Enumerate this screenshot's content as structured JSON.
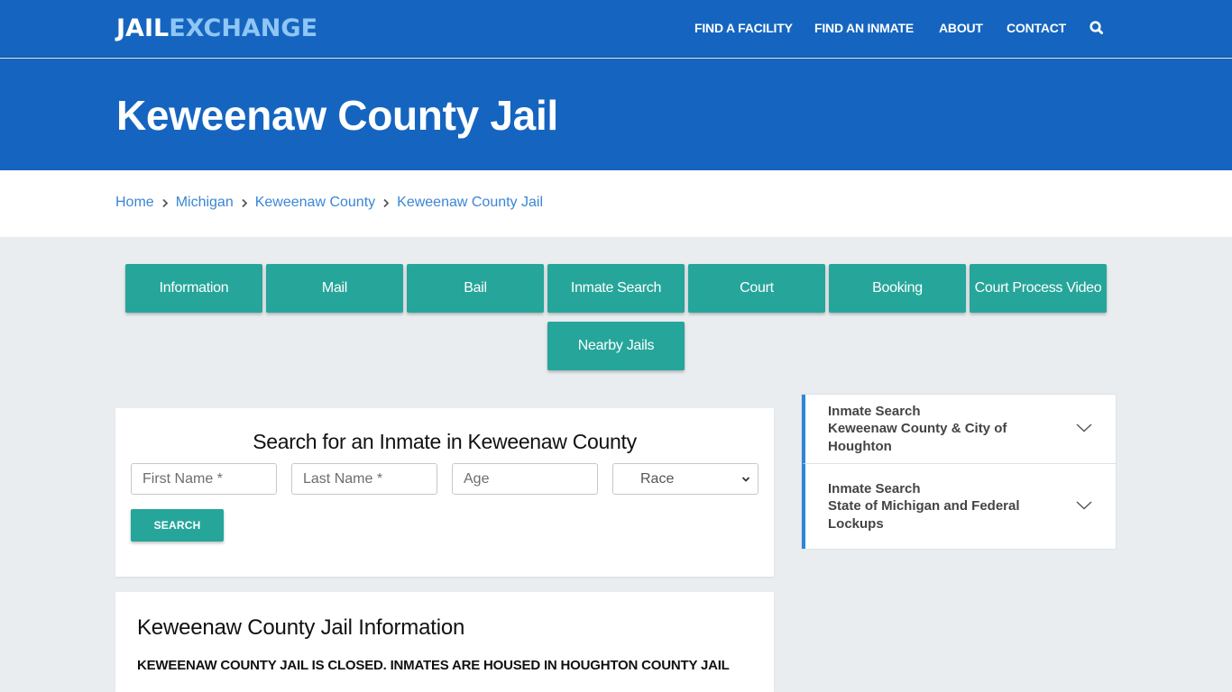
{
  "header": {
    "logo_part1": "JAIL",
    "logo_part2": "EXCHANGE",
    "nav": [
      "FIND A FACILITY",
      "FIND AN INMATE",
      "ABOUT",
      "CONTACT"
    ],
    "search_icon": "search-icon"
  },
  "hero": {
    "title": "Keweenaw County Jail"
  },
  "breadcrumb": [
    "Home",
    "Michigan",
    "Keweenaw County",
    "Keweenaw County Jail"
  ],
  "tabs": [
    "Information",
    "Mail",
    "Bail",
    "Inmate Search",
    "Court",
    "Booking",
    "Court Process Video",
    "Nearby Jails"
  ],
  "search_form": {
    "title": "Search for an Inmate in Keweenaw County",
    "first_name_placeholder": "First Name *",
    "last_name_placeholder": "Last Name *",
    "age_placeholder": "Age",
    "race_selected": "Race",
    "submit_label": "SEARCH"
  },
  "info": {
    "title": "Keweenaw County Jail Information",
    "notice": "KEWEENAW COUNTY JAIL IS CLOSED. INMATES ARE HOUSED IN HOUGHTON COUNTY JAIL"
  },
  "sidebar": {
    "items": [
      {
        "line1": "Inmate Search",
        "line2": "Keweenaw County & City of Houghton"
      },
      {
        "line1": "Inmate Search",
        "line2": "State of Michigan and Federal Lockups"
      }
    ]
  },
  "colors": {
    "brand_blue": "#1565c0",
    "logo_light": "#90c6f5",
    "teal": "#26a69a",
    "link": "#3a86d6",
    "accent_border": "#2f86d6"
  }
}
